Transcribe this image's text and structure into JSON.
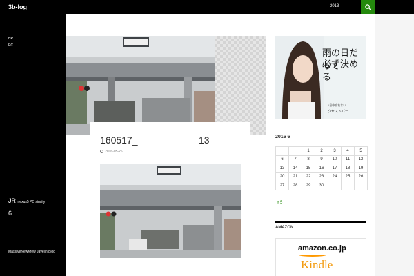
{
  "header": {
    "site_title": "3b-log",
    "nav_item": "2013",
    "search_icon": "search-icon"
  },
  "left_sidebar": {
    "menu": [
      "HP",
      "PC"
    ],
    "widget_title_main": "JR",
    "widget_title_small": "nexus5 PC sincity",
    "widget_number": "6",
    "footer_links": "MassiveNewKrew  Javelin  Blog"
  },
  "post": {
    "title": "160517_",
    "title_num": "13",
    "date": "2016-05-26"
  },
  "ad": {
    "line1": "雨の日だって",
    "line2": "必ず決める",
    "small": "1日中崩れない",
    "brand": "クセストパー"
  },
  "calendar": {
    "caption": "2016  6",
    "rows": [
      [
        "",
        "",
        "1",
        "2",
        "3",
        "4",
        "5"
      ],
      [
        "6",
        "7",
        "8",
        "9",
        "10",
        "11",
        "12"
      ],
      [
        "13",
        "14",
        "15",
        "16",
        "17",
        "18",
        "19"
      ],
      [
        "20",
        "21",
        "22",
        "23",
        "24",
        "25",
        "26"
      ],
      [
        "27",
        "28",
        "29",
        "30",
        "",
        "",
        ""
      ]
    ],
    "prev_link": "« 5"
  },
  "amazon": {
    "title": "AMAZON",
    "logo": "amazon.co.jp",
    "kindle": "Kindle"
  },
  "colors": {
    "accent": "#24890d",
    "header_bg": "#000000"
  }
}
